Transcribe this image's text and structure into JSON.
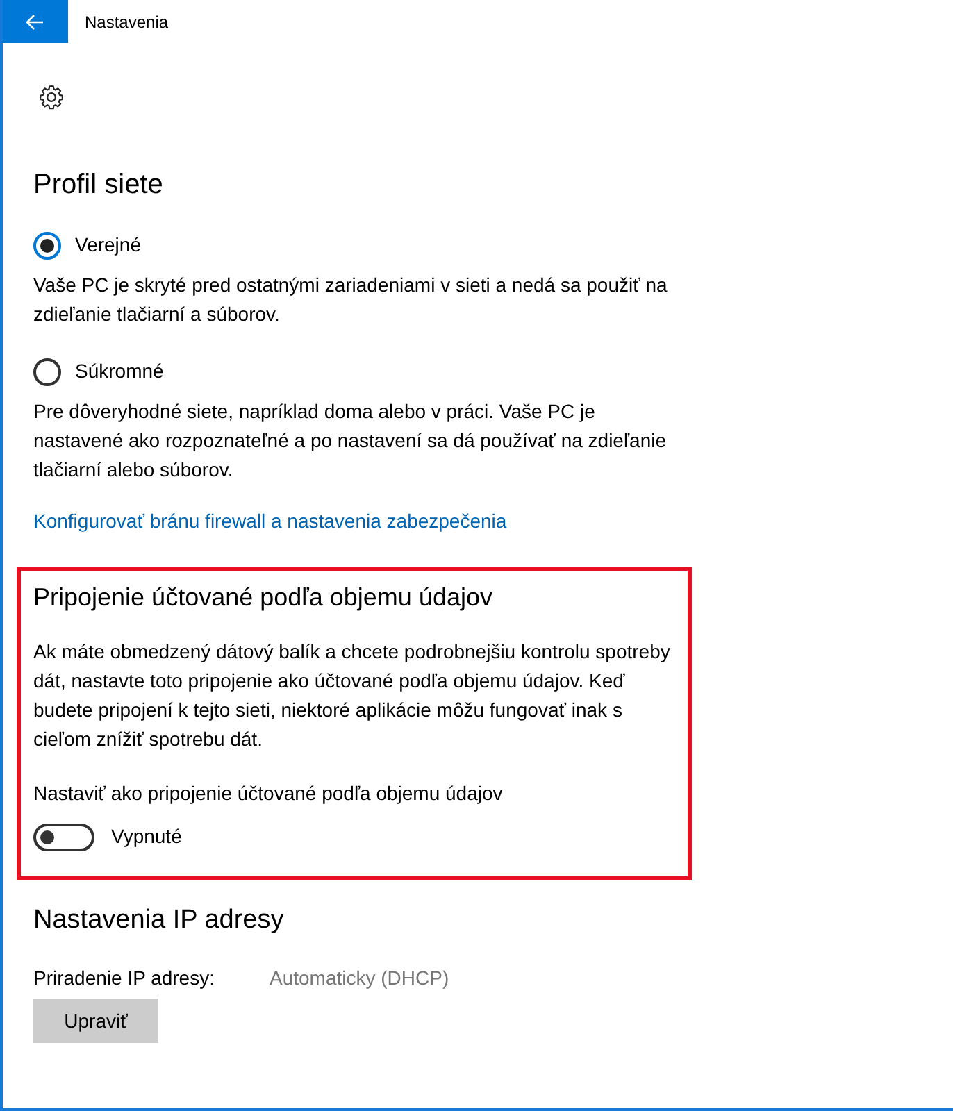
{
  "window": {
    "title": "Nastavenia"
  },
  "network_profile": {
    "heading": "Profil siete",
    "options": [
      {
        "label": "Verejné",
        "selected": true,
        "description": "Vaše PC je skryté pred ostatnými zariadeniami v sieti a nedá sa použiť na zdieľanie tlačiarní a súborov."
      },
      {
        "label": "Súkromné",
        "selected": false,
        "description": "Pre dôveryhodné siete, napríklad doma alebo v práci. Vaše PC je nastavené ako rozpoznateľné a po nastavení sa dá používať na zdieľanie tlačiarní alebo súborov."
      }
    ],
    "link": "Konfigurovať bránu firewall a nastavenia zabezpečenia"
  },
  "metered_connection": {
    "heading": "Pripojenie účtované podľa objemu údajov",
    "description": "Ak máte obmedzený dátový balík a chcete podrobnejšiu kontrolu spotreby dát, nastavte toto pripojenie ako účtované podľa objemu údajov. Keď budete pripojení k tejto sieti, niektoré aplikácie môžu fungovať inak s cieľom znížiť spotrebu dát.",
    "toggle_label": "Nastaviť ako pripojenie účtované podľa objemu údajov",
    "toggle": {
      "on": false,
      "state_text": "Vypnuté"
    }
  },
  "ip_settings": {
    "heading": "Nastavenia IP adresy",
    "label": "Priradenie IP adresy:",
    "value": "Automaticky (DHCP)",
    "button": "Upraviť"
  }
}
